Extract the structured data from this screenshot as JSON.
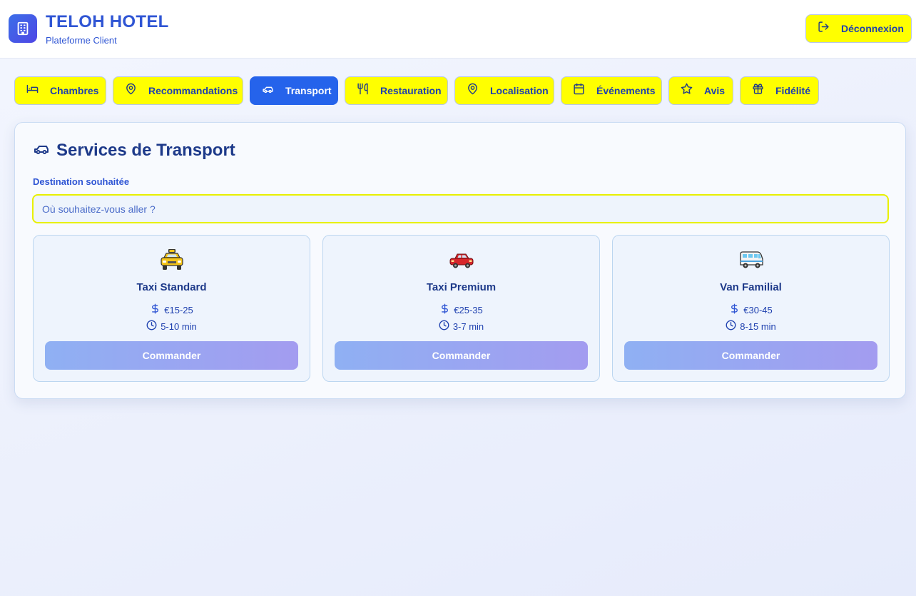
{
  "header": {
    "title": "TELOH HOTEL",
    "subtitle": "Plateforme Client",
    "logout_label": "Déconnexion"
  },
  "tabs": [
    {
      "label": "Chambres",
      "icon": "bed-icon"
    },
    {
      "label": "Recommandations",
      "icon": "map-pin-icon"
    },
    {
      "label": "Transport",
      "icon": "car-icon",
      "active": true
    },
    {
      "label": "Restauration",
      "icon": "utensils-icon"
    },
    {
      "label": "Localisation",
      "icon": "map-pin-icon"
    },
    {
      "label": "Événements",
      "icon": "calendar-icon"
    },
    {
      "label": "Avis",
      "icon": "star-icon"
    },
    {
      "label": "Fidélité",
      "icon": "gift-icon"
    }
  ],
  "transport": {
    "title": "Services de Transport",
    "destination_label": "Destination souhaitée",
    "destination_placeholder": "Où souhaitez-vous aller ?",
    "destination_value": "",
    "services": [
      {
        "name": "Taxi Standard",
        "icon": "taxi-icon",
        "price": "€15-25",
        "time": "5-10 min",
        "button": "Commander"
      },
      {
        "name": "Taxi Premium",
        "icon": "red-car-icon",
        "price": "€25-35",
        "time": "3-7 min",
        "button": "Commander"
      },
      {
        "name": "Van Familial",
        "icon": "van-icon",
        "price": "€30-45",
        "time": "8-15 min",
        "button": "Commander"
      }
    ]
  },
  "colors": {
    "brand": "#2f55d4",
    "accent_yellow": "#ffff00",
    "active_tab": "#2563eb",
    "text_dark": "#1e3a8a"
  }
}
